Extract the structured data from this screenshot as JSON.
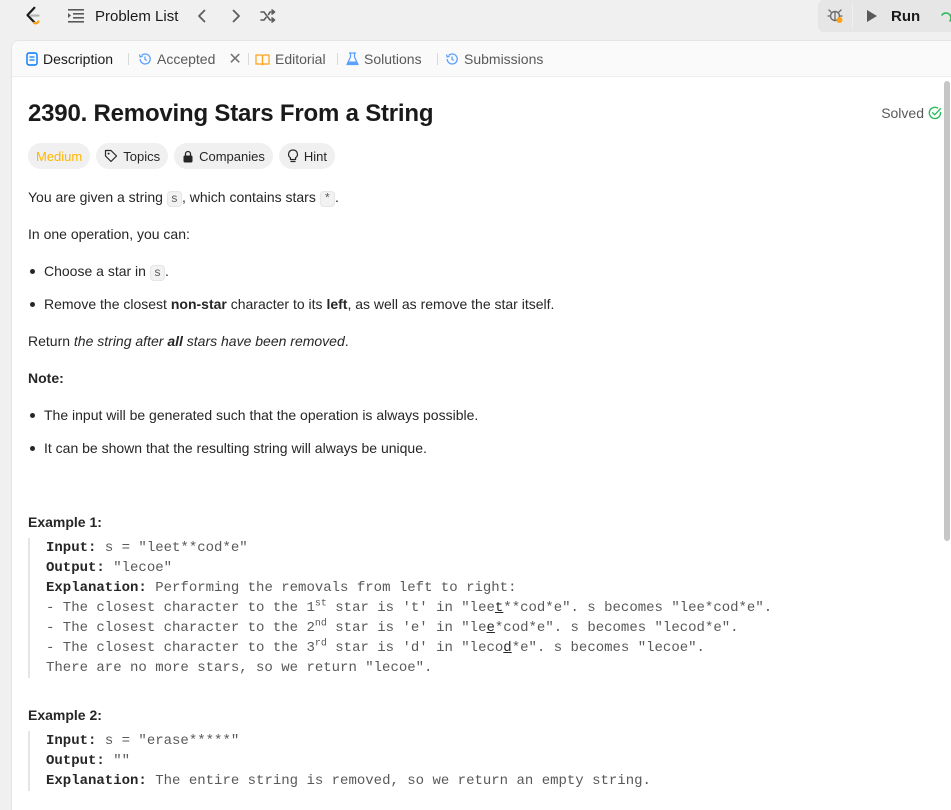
{
  "topbar": {
    "problem_list_label": "Problem List",
    "run_label": "Run"
  },
  "tabs": [
    {
      "label": "Description",
      "icon": "document-icon"
    },
    {
      "label": "Accepted",
      "icon": "history-icon"
    },
    {
      "label": "Editorial",
      "icon": "book-icon"
    },
    {
      "label": "Solutions",
      "icon": "flask-icon"
    },
    {
      "label": "Submissions",
      "icon": "history-icon"
    }
  ],
  "tab_close": "✕",
  "problem": {
    "title": "2390. Removing Stars From a String",
    "status": "Solved",
    "tags": {
      "difficulty": "Medium",
      "topics": "Topics",
      "companies": "Companies",
      "hint": "Hint"
    },
    "desc": {
      "p1_a": "You are given a string ",
      "p1_code1": "s",
      "p1_b": ", which contains stars ",
      "p1_code2": "*",
      "p1_c": ".",
      "p2": "In one operation, you can:",
      "li1_a": "Choose a star in ",
      "li1_code": "s",
      "li1_b": ".",
      "li2_a": "Remove the closest ",
      "li2_b1": "non-star",
      "li2_c": " character to its ",
      "li2_b2": "left",
      "li2_d": ", as well as remove the star itself.",
      "p3_a": "Return ",
      "p3_i1": "the string after ",
      "p3_bi": "all",
      "p3_i2": " stars have been removed",
      "p3_b": ".",
      "note": "Note:",
      "n1": "The input will be generated such that the operation is always possible.",
      "n2": "It can be shown that the resulting string will always be unique."
    },
    "example1": {
      "title": "Example 1:",
      "input_label": "Input:",
      "input_value": " s = \"leet**cod*e\"",
      "output_label": "Output:",
      "output_value": " \"lecoe\"",
      "explanation_label": "Explanation:",
      "explanation_value": " Performing the removals from left to right:",
      "l1_a": "- The closest character to the 1",
      "l1_sup": "st",
      "l1_b": " star is 't' in \"lee",
      "l1_u": "t",
      "l1_c": "**cod*e\". s becomes \"lee*cod*e\".",
      "l2_a": "- The closest character to the 2",
      "l2_sup": "nd",
      "l2_b": " star is 'e' in \"le",
      "l2_u": "e",
      "l2_c": "*cod*e\". s becomes \"lecod*e\".",
      "l3_a": "- The closest character to the 3",
      "l3_sup": "rd",
      "l3_b": " star is 'd' in \"leco",
      "l3_u": "d",
      "l3_c": "*e\". s becomes \"lecoe\".",
      "l4": "There are no more stars, so we return \"lecoe\"."
    },
    "example2": {
      "title": "Example 2:",
      "input_label": "Input:",
      "input_value": " s = \"erase*****\"",
      "output_label": "Output:",
      "output_value": " \"\"",
      "explanation_label": "Explanation:",
      "explanation_value": " The entire string is removed, so we return an empty string."
    }
  },
  "colors": {
    "medium": "#ffb700",
    "solved": "#2cbb5d",
    "accent_blue": "#007aff"
  }
}
